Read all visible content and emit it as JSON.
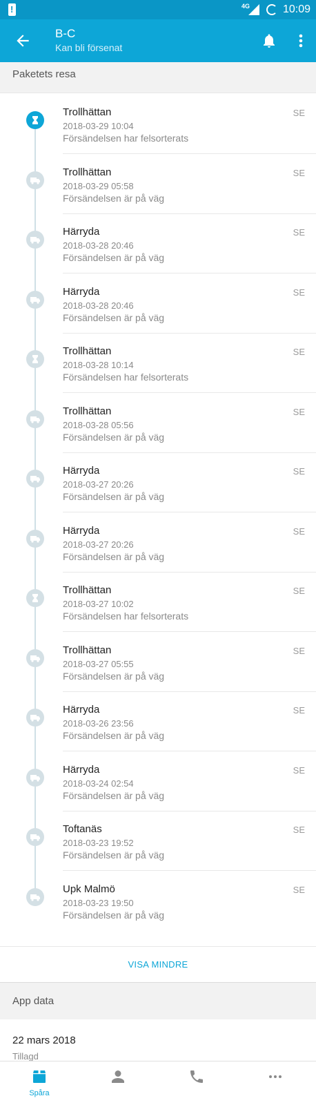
{
  "status_bar": {
    "network": "4G",
    "time": "10:09"
  },
  "header": {
    "title": "B-C",
    "subtitle": "Kan bli försenat",
    "bar_color": "#0da6d7"
  },
  "journey": {
    "section_title": "Paketets resa",
    "events": [
      {
        "city": "Trollhättan",
        "date": "2018-03-29 10:04",
        "message": "Försändelsen har felsorterats",
        "country": "SE",
        "icon": "hourglass-icon",
        "active": true
      },
      {
        "city": "Trollhättan",
        "date": "2018-03-29 05:58",
        "message": "Försändelsen är på väg",
        "country": "SE",
        "icon": "truck-icon"
      },
      {
        "city": "Härryda",
        "date": "2018-03-28 20:46",
        "message": "Försändelsen är på väg",
        "country": "SE",
        "icon": "truck-icon"
      },
      {
        "city": "Härryda",
        "date": "2018-03-28 20:46",
        "message": "Försändelsen är på väg",
        "country": "SE",
        "icon": "truck-icon"
      },
      {
        "city": "Trollhättan",
        "date": "2018-03-28 10:14",
        "message": "Försändelsen har felsorterats",
        "country": "SE",
        "icon": "hourglass-icon"
      },
      {
        "city": "Trollhättan",
        "date": "2018-03-28 05:56",
        "message": "Försändelsen är på väg",
        "country": "SE",
        "icon": "truck-icon"
      },
      {
        "city": "Härryda",
        "date": "2018-03-27 20:26",
        "message": "Försändelsen är på väg",
        "country": "SE",
        "icon": "truck-icon"
      },
      {
        "city": "Härryda",
        "date": "2018-03-27 20:26",
        "message": "Försändelsen är på väg",
        "country": "SE",
        "icon": "truck-icon"
      },
      {
        "city": "Trollhättan",
        "date": "2018-03-27 10:02",
        "message": "Försändelsen har felsorterats",
        "country": "SE",
        "icon": "hourglass-icon"
      },
      {
        "city": "Trollhättan",
        "date": "2018-03-27 05:55",
        "message": "Försändelsen är på väg",
        "country": "SE",
        "icon": "truck-icon"
      },
      {
        "city": "Härryda",
        "date": "2018-03-26 23:56",
        "message": "Försändelsen är på väg",
        "country": "SE",
        "icon": "truck-icon"
      },
      {
        "city": "Härryda",
        "date": "2018-03-24 02:54",
        "message": "Försändelsen är på väg",
        "country": "SE",
        "icon": "truck-icon"
      },
      {
        "city": "Toftanäs",
        "date": "2018-03-23 19:52",
        "message": "Försändelsen är på väg",
        "country": "SE",
        "icon": "truck-icon"
      },
      {
        "city": "Upk Malmö",
        "date": "2018-03-23 19:50",
        "message": "Försändelsen är på väg",
        "country": "SE",
        "icon": "truck-icon"
      }
    ],
    "show_less_label": "VISA MINDRE"
  },
  "app_data": {
    "section_title": "App data",
    "added_date": "22 mars 2018",
    "added_label": "Tillagd"
  },
  "bottom_nav": {
    "items": [
      {
        "label": "Spåra",
        "icon": "package-icon",
        "active": true
      },
      {
        "label": "",
        "icon": "person-icon"
      },
      {
        "label": "",
        "icon": "phone-icon"
      },
      {
        "label": "",
        "icon": "more-horizontal-icon"
      }
    ]
  }
}
